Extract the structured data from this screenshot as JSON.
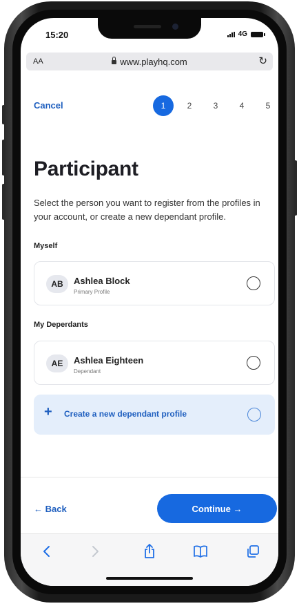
{
  "status_bar": {
    "time": "15:20",
    "network": "4G"
  },
  "browser": {
    "text_size_label": "AA",
    "url": "www.playhq.com"
  },
  "header": {
    "cancel_label": "Cancel",
    "steps": [
      "1",
      "2",
      "3",
      "4",
      "5"
    ],
    "active_step": "1"
  },
  "page": {
    "title": "Participant",
    "subtitle": "Select the person you want to register from the profiles in your account, or create a new dependant profile."
  },
  "myself": {
    "section_label": "Myself",
    "profile": {
      "initials": "AB",
      "name": "Ashlea Block",
      "type": "Primary Profile",
      "selected": false
    }
  },
  "dependants": {
    "section_label": "My Deperdants",
    "profile": {
      "initials": "AE",
      "name": "Ashlea Eighteen",
      "type": "Dependant",
      "selected": false
    }
  },
  "create_profile": {
    "label": "Create a new dependant profile"
  },
  "footer": {
    "back_label": "← Back",
    "continue_label": "Continue →"
  },
  "safari_toolbar": {
    "icons": [
      "back-arrow-icon",
      "forward-arrow-icon",
      "share-icon",
      "bookmarks-icon",
      "tabs-icon"
    ]
  },
  "colors": {
    "accent": "#1769e0",
    "create_bg": "#e4eefb",
    "text_dark": "#1e1e24"
  }
}
